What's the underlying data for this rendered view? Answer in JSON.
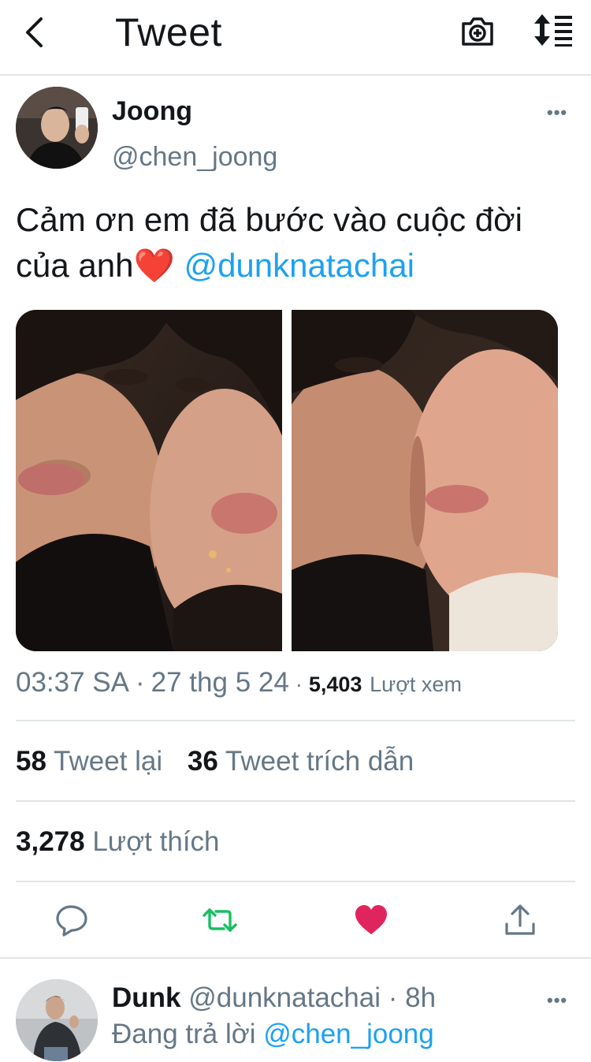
{
  "header": {
    "title": "Tweet",
    "back_icon": "chevron-left-icon",
    "camera_icon": "camera-add-icon",
    "sort_icon": "sort-lines-icon"
  },
  "tweet": {
    "author_name": "Joong",
    "author_handle": "@chen_joong",
    "more_label": "•••",
    "text": "Cảm ơn em đã bước vào cuộc đời của anh",
    "emoji": "❤️",
    "mention": "@dunknatachai",
    "time": "03:37 SA",
    "separator": "·",
    "date": "27 thg 5 24",
    "views_count": "5,403",
    "views_label": "Lượt xem",
    "retweets_count": "58",
    "retweets_label": "Tweet lại",
    "quotes_count": "36",
    "quotes_label": "Tweet trích dẫn",
    "likes_count": "3,278",
    "likes_label": "Lượt thích"
  },
  "actions": {
    "reply_icon": "reply-bubble-icon",
    "retweet_icon": "retweet-icon",
    "like_icon": "heart-icon",
    "share_icon": "share-icon"
  },
  "reply": {
    "author_name": "Dunk",
    "author_handle": "@dunknatachai",
    "separator": "·",
    "age": "8h",
    "replying_prefix": "Đang trả lời",
    "replying_to": "@chen_joong",
    "more_label": "•••"
  },
  "colors": {
    "accent": "#1da1f2",
    "retweet_green": "#17bf63",
    "like_red": "#e0245e",
    "muted_text": "#657786",
    "divider": "#e1e5e8"
  }
}
